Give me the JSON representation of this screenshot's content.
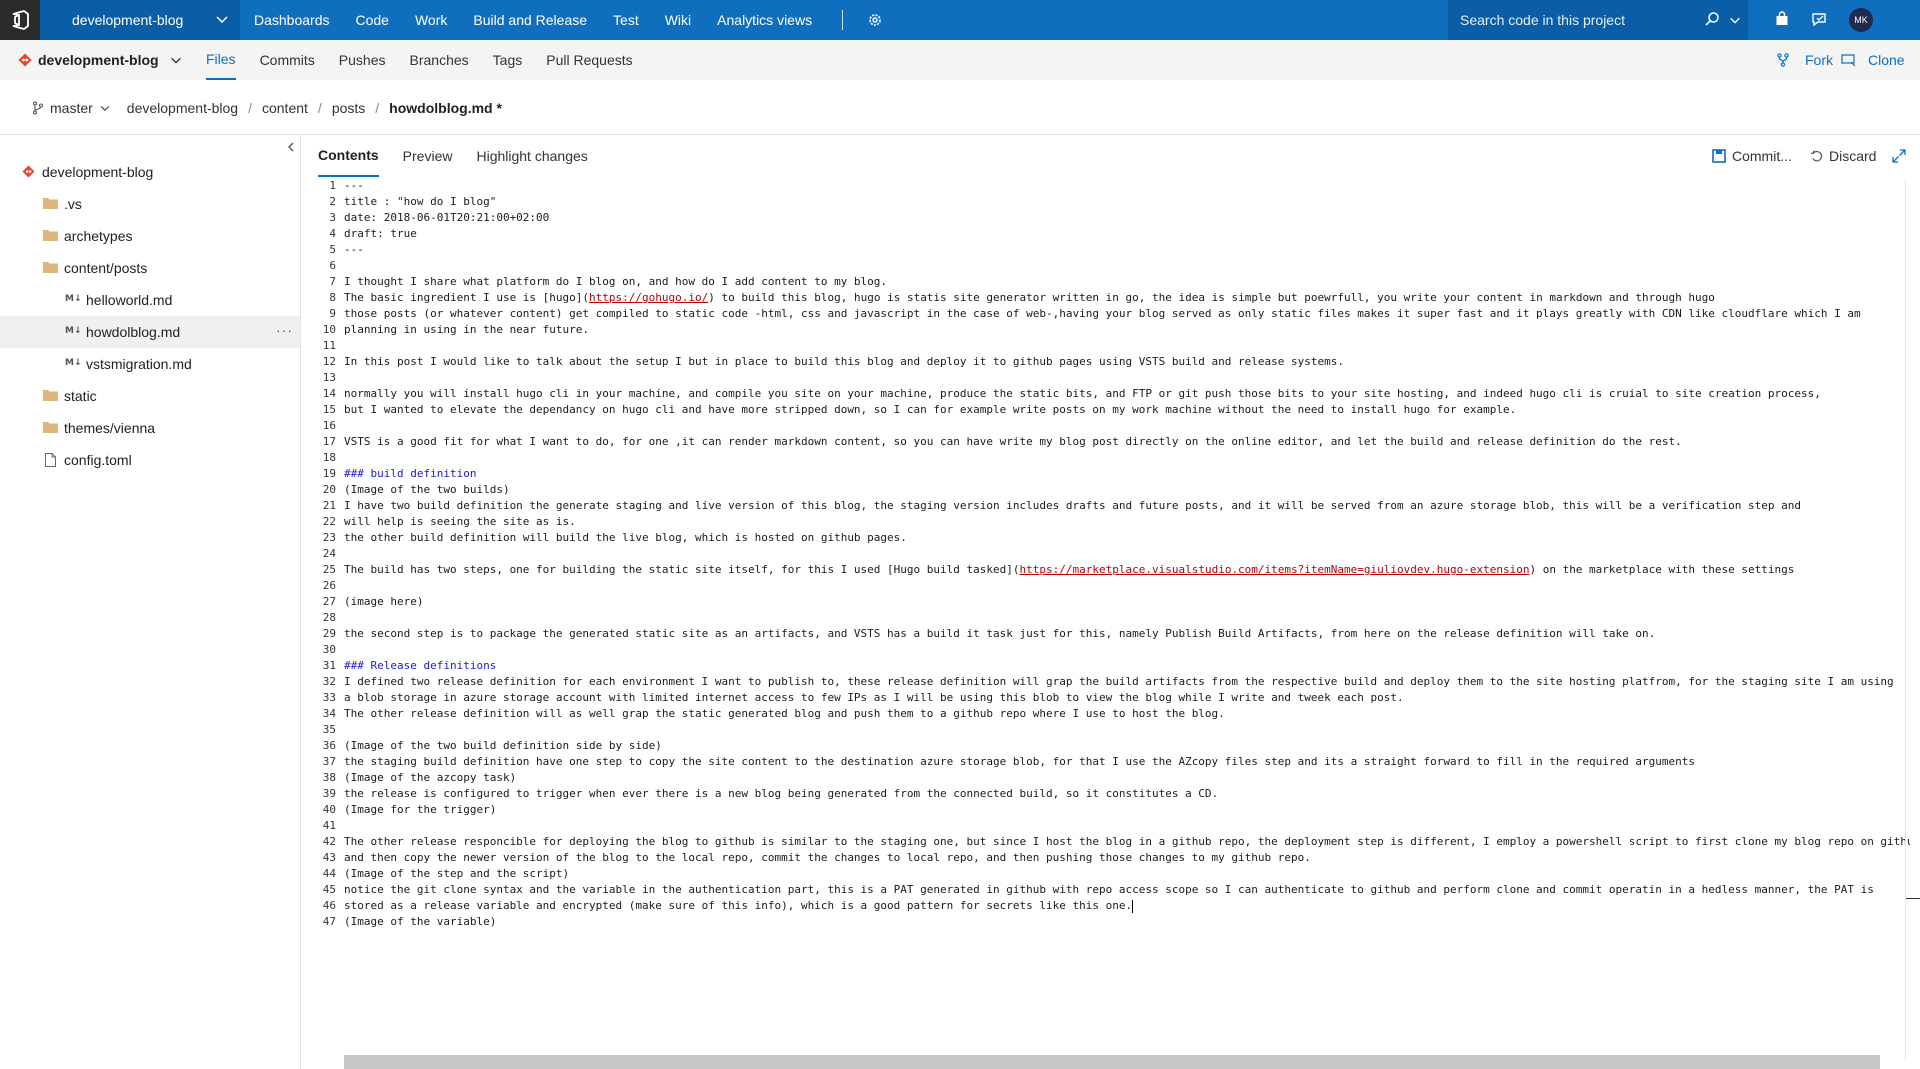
{
  "topbar": {
    "project": "development-blog",
    "nav": [
      "Dashboards",
      "Code",
      "Work",
      "Build and Release",
      "Test",
      "Wiki",
      "Analytics views"
    ],
    "search_placeholder": "Search code in this project",
    "avatar_initials": "MK",
    "bg_color": "#106ebe"
  },
  "subbar": {
    "repo": "development-blog",
    "tabs": [
      "Files",
      "Commits",
      "Pushes",
      "Branches",
      "Tags",
      "Pull Requests"
    ],
    "active_tab": "Files",
    "fork_label": "Fork",
    "clone_label": "Clone"
  },
  "breadcrumb": {
    "branch": "master",
    "parts": [
      "development-blog",
      "content",
      "posts"
    ],
    "file": "howdolblog.md *"
  },
  "tree": {
    "root": "development-blog",
    "items": [
      {
        "label": ".vs",
        "type": "folder"
      },
      {
        "label": "archetypes",
        "type": "folder"
      },
      {
        "label": "content/posts",
        "type": "folder"
      },
      {
        "label": "helloworld.md",
        "type": "md"
      },
      {
        "label": "howdolblog.md",
        "type": "md"
      },
      {
        "label": "vstsmigration.md",
        "type": "md"
      },
      {
        "label": "static",
        "type": "folder"
      },
      {
        "label": "themes/vienna",
        "type": "folder"
      },
      {
        "label": "config.toml",
        "type": "file"
      }
    ]
  },
  "editor": {
    "tabs": [
      "Contents",
      "Preview",
      "Highlight changes"
    ],
    "commit_label": "Commit...",
    "discard_label": "Discard",
    "lines": [
      "---",
      "title : \"how do I blog\"",
      "date: 2018-06-01T20:21:00+02:00",
      "draft: true",
      "---",
      "",
      "I thought I share what platform do I blog on, and how do I add content to my blog.",
      "The basic ingredient I use is [hugo](https://gohugo.io/) to build this blog, hugo is statis site generator written in go, the idea is simple but poewrfull, you write your content in markdown and through hugo",
      "those posts (or whatever content) get compiled to static code -html, css and javascript in the case of web-,having your blog served as only static files makes it super fast and it plays greatly with CDN like cloudflare which I am",
      "planning in using in the near future.",
      "",
      "In this post I would like to talk about the setup I but in place to build this blog and deploy it to github pages using VSTS build and release systems.",
      "",
      "normally you will install hugo cli in your machine, and compile you site on your machine, produce the static bits, and FTP or git push those bits to your site hosting, and indeed hugo cli is cruial to site creation process,",
      "but I wanted to elevate the dependancy on hugo cli and have more stripped down, so I can for example write posts on my work machine without the need to install hugo for example.",
      "",
      "VSTS is a good fit for what I want to do, for one ,it can render markdown content, so you can have write my blog post directly on the online editor, and let the build and release definition do the rest.",
      "",
      "### build definition",
      "(Image of the two builds)",
      "I have two build definition the generate staging and live version of this blog, the staging version includes drafts and future posts, and it will be served from an azure storage blob, this will be a verification step and",
      "will help is seeing the site as is.",
      "the other build definition will build the live blog, which is hosted on github pages.",
      "",
      "The build has two steps, one for building the static site itself, for this I used [Hugo build tasked](https://marketplace.visualstudio.com/items?itemName=giuliovdev.hugo-extension) on the marketplace with these settings",
      "",
      "(image here)",
      "",
      "the second step is to package the generated static site as an artifacts, and VSTS has a build it task just for this, namely Publish Build Artifacts, from here on the release definition will take on.",
      "",
      "### Release definitions",
      "I defined two release definition for each environment I want to publish to, these release definition will grap the build artifacts from the respective build and deploy them to the site hosting platfrom, for the staging site I am using",
      "a blob storage in azure storage account with limited internet access to few IPs as I will be using this blob to view the blog while I write and tweek each post.",
      "The other release definition will as well grap the static generated blog and push them to a github repo where I use to host the blog.",
      "",
      "(Image of the two build definition side by side)",
      "the staging build definition have one step to copy the site content to the destination azure storage blob, for that I use the AZcopy files step and its a straight forward to fill in the required arguments",
      "(Image of the azcopy task)",
      "the release is configured to trigger when ever there is a new blog being generated from the connected build, so it constitutes a CD.",
      "(Image for the trigger)",
      "",
      "The other release responcible for deploying the blog to github is similar to the staging one, but since I host the blog in a github repo, the deployment step is different, I employ a powershell script to first clone my blog repo on github",
      "and then copy the newer version of the blog to the local repo, commit the changes to local repo, and then pushing those changes to my github repo.",
      "(Image of the step and the script)",
      "notice the git clone syntax and the variable in the authentication part, this is a PAT generated in github with repo access scope so I can authenticate to github and perform clone and commit operatin in a hedless manner, the PAT is",
      "stored as a release variable and encrypted (make sure of this info), which is a good pattern for secrets like this one.",
      "(Image of the variable)"
    ]
  }
}
